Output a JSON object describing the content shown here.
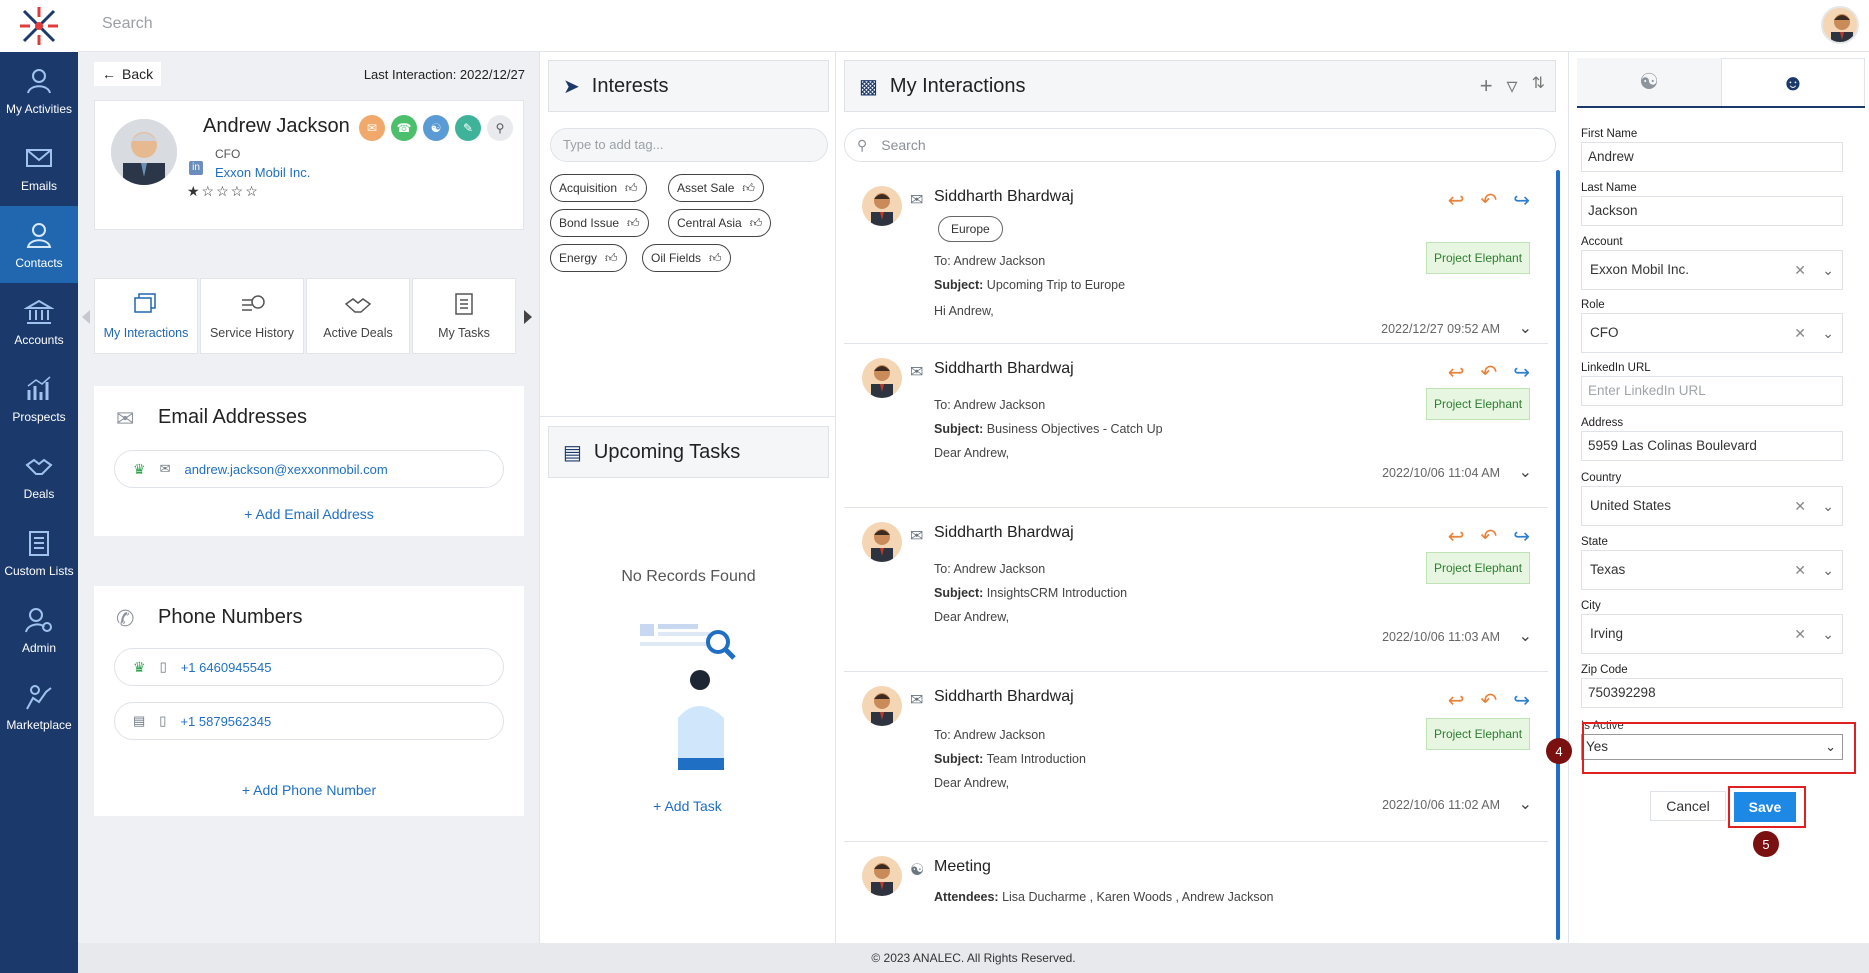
{
  "topbar": {
    "search_placeholder": "Search"
  },
  "nav": {
    "items": [
      {
        "label": "My Activities",
        "icon": "person-activity-icon"
      },
      {
        "label": "Emails",
        "icon": "envelope-icon"
      },
      {
        "label": "Contacts",
        "icon": "contact-icon",
        "active": true
      },
      {
        "label": "Accounts",
        "icon": "bank-icon"
      },
      {
        "label": "Prospects",
        "icon": "chart-icon"
      },
      {
        "label": "Deals",
        "icon": "handshake-icon"
      },
      {
        "label": "Custom Lists",
        "icon": "list-icon"
      },
      {
        "label": "Admin",
        "icon": "admin-gear-icon"
      },
      {
        "label": "Marketplace",
        "icon": "marketplace-icon"
      }
    ]
  },
  "contact": {
    "back_label": "Back",
    "last_interaction": "Last Interaction: 2022/12/27",
    "name": "Andrew Jackson",
    "title": "CFO",
    "company": "Exxon Mobil Inc.",
    "rating_stars": "★☆☆☆☆",
    "rating": 1
  },
  "tabs": [
    {
      "label": "My Interactions",
      "active": true
    },
    {
      "label": "Service History"
    },
    {
      "label": "Active Deals"
    },
    {
      "label": "My Tasks"
    }
  ],
  "emails": {
    "title": "Email Addresses",
    "items": [
      "andrew.jackson@xexxonmobil.com"
    ],
    "add_label": "+ Add Email Address"
  },
  "phones": {
    "title": "Phone Numbers",
    "items": [
      "+1 6460945545",
      "+1 5879562345"
    ],
    "add_label": "+ Add Phone Number"
  },
  "interests": {
    "title": "Interests",
    "tag_placeholder": "Type to add tag...",
    "tags": [
      "Acquisition",
      "Asset Sale",
      "Bond Issue",
      "Central Asia",
      "Energy",
      "Oil Fields"
    ]
  },
  "tasks": {
    "title": "Upcoming Tasks",
    "empty_text": "No Records Found",
    "add_label": "+ Add Task"
  },
  "interactions": {
    "title": "My Interactions",
    "search_placeholder": "Search",
    "cards": [
      {
        "from": "Siddharth Bhardwaj",
        "chip": "Europe",
        "to": "To: Andrew Jackson",
        "subject_label": "Subject:",
        "subject": "Upcoming Trip to Europe",
        "greeting": "Hi Andrew,",
        "project": "Project Elephant",
        "timestamp": "2022/12/27 09:52 AM"
      },
      {
        "from": "Siddharth Bhardwaj",
        "to": "To: Andrew Jackson",
        "subject_label": "Subject:",
        "subject": "Business Objectives - Catch Up",
        "greeting": "Dear Andrew,",
        "project": "Project Elephant",
        "timestamp": "2022/10/06 11:04 AM"
      },
      {
        "from": "Siddharth Bhardwaj",
        "to": "To: Andrew Jackson",
        "subject_label": "Subject:",
        "subject": "InsightsCRM Introduction",
        "greeting": "Dear Andrew,",
        "project": "Project Elephant",
        "timestamp": "2022/10/06 11:03 AM"
      },
      {
        "from": "Siddharth Bhardwaj",
        "to": "To: Andrew Jackson",
        "subject_label": "Subject:",
        "subject": "Team Introduction",
        "greeting": "Dear Andrew,",
        "project": "Project Elephant",
        "timestamp": "2022/10/06 11:02 AM"
      },
      {
        "from": "Meeting",
        "to": "Attendees:",
        "subject": "Lisa Ducharme , Karen Woods , Andrew Jackson"
      }
    ]
  },
  "form": {
    "first_name_label": "First Name",
    "first_name": "Andrew",
    "last_name_label": "Last Name",
    "last_name": "Jackson",
    "account_label": "Account",
    "account": "Exxon Mobil Inc.",
    "role_label": "Role",
    "role": "CFO",
    "linkedin_label": "LinkedIn URL",
    "linkedin_placeholder": "Enter LinkedIn URL",
    "address_label": "Address",
    "address": "5959 Las Colinas Boulevard",
    "country_label": "Country",
    "country": "United States",
    "state_label": "State",
    "state": "Texas",
    "city_label": "City",
    "city": "Irving",
    "zip_label": "Zip Code",
    "zip": "750392298",
    "is_active_label": "Is Active",
    "is_active": "Yes",
    "cancel_label": "Cancel",
    "save_label": "Save"
  },
  "annotations": {
    "step4": "4",
    "step5": "5"
  },
  "footer": {
    "text": "© 2023 ANALEC. All Rights Reserved."
  },
  "colors": {
    "nav_bg": "#1b3a6b",
    "nav_active": "#2067b0",
    "link": "#1f6fc5",
    "save": "#1e88e5",
    "highlight": "#e02020"
  }
}
